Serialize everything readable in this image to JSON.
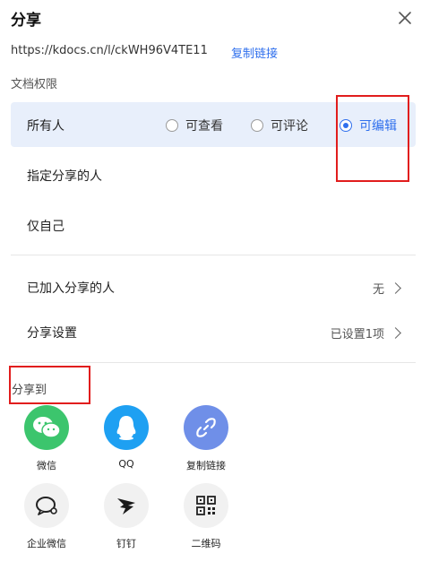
{
  "header": {
    "title": "分享"
  },
  "link": {
    "url": "https://kdocs.cn/l/ckWH96V4TE11",
    "copy_label": "复制链接"
  },
  "permissions": {
    "section_label": "文档权限",
    "everyone_label": "所有人",
    "options": [
      "可查看",
      "可评论",
      "可编辑"
    ],
    "selected": "可编辑",
    "specified_label": "指定分享的人",
    "self_label": "仅自己"
  },
  "settings": {
    "joined_label": "已加入分享的人",
    "joined_value": "无",
    "share_settings_label": "分享设置",
    "share_settings_value": "已设置1项"
  },
  "share_to": {
    "label": "分享到",
    "items": [
      {
        "label": "微信",
        "icon": "wechat-icon",
        "color": "#3cc56d"
      },
      {
        "label": "QQ",
        "icon": "qq-icon",
        "color": "#1ea0f2"
      },
      {
        "label": "复制链接",
        "icon": "link-icon",
        "color": "#6f8fe8"
      },
      {
        "label": "企业微信",
        "icon": "wework-icon",
        "color": "#f1f1f1"
      },
      {
        "label": "钉钉",
        "icon": "dingtalk-icon",
        "color": "#f1f1f1"
      },
      {
        "label": "二维码",
        "icon": "qrcode-icon",
        "color": "#f1f1f1"
      }
    ]
  },
  "colors": {
    "accent": "#2f6fed",
    "highlight_row": "#e8effb",
    "annotation_red": "#e11d1d"
  }
}
